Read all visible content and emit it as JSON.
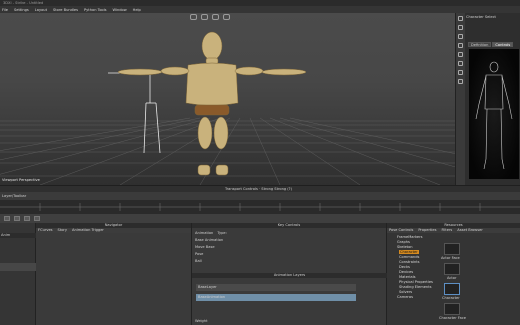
{
  "window": {
    "title": "3DXI - Strike - Untitled"
  },
  "menu": [
    "File",
    "Settings",
    "Layout",
    "Store Bundles",
    "Python Tools",
    "Window",
    "Help"
  ],
  "viewport": {
    "label": "Viewport Perspective",
    "toolbar_icons": [
      "frame-icon",
      "camera-icon",
      "light-icon",
      "refresh-icon"
    ]
  },
  "right_panel": {
    "title": "Character Select",
    "tabs": [
      "Definition",
      "Controls"
    ],
    "tools": [
      "select-icon",
      "move-icon",
      "rotate-icon",
      "scale-icon",
      "keyframe-icon",
      "lock-icon",
      "pin-icon",
      "filter-icon"
    ]
  },
  "transport": {
    "title": "Transport Controls  ·  Strong Strong (?)",
    "header": "Layer/Toolbar"
  },
  "navigator": {
    "title": "Navigator",
    "tabs": [
      "Anim",
      "FCurves",
      "Story",
      "Animation Trigger"
    ]
  },
  "key_controls": {
    "title": "Key Controls",
    "fields": [
      "Animation",
      "Type:",
      "Base Animation",
      "Move Base",
      "Pose",
      "Ball"
    ],
    "layers_title": "Animation Layers",
    "layers": [
      "BaseLayer",
      "BaseAnimation"
    ],
    "weight_label": "Weight"
  },
  "scene": {
    "title": "Resources",
    "tabs": [
      "Pose Controls",
      "Properties",
      "Filters",
      "Asset Browser",
      "Groups",
      "Sets"
    ],
    "tree": [
      "FrameMarkers",
      "Graphs",
      "Skeleton",
      "Character",
      "Commands",
      "Constraints",
      "Decks",
      "Devices",
      "Materials",
      "Physical Properties",
      "Shading Elements",
      "Solvers",
      "Cameras"
    ],
    "selected": "Character",
    "assets": [
      "Actor Face",
      "Actor",
      "Character",
      "Character Face"
    ]
  },
  "colors": {
    "accent": "#d58a1f",
    "character_body": "#c8b07a",
    "character_joint": "#8a5a2a",
    "grid": "#6a6a6a"
  }
}
